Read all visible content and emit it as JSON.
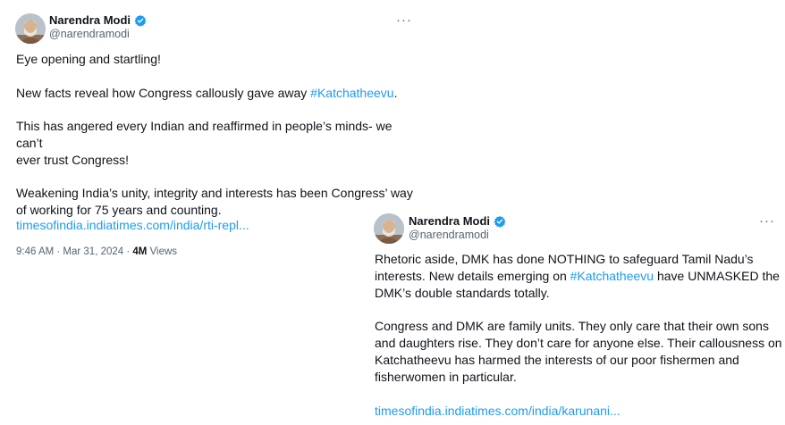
{
  "tweets": [
    {
      "author": {
        "name": "Narendra Modi",
        "handle": "@narendramodi",
        "verified_icon": "verified-badge-icon",
        "badge_color": "#1d9bf0"
      },
      "more_label": "···",
      "paragraphs": [
        {
          "text": "Eye opening and startling!"
        },
        {
          "before": "New facts reveal how Congress callously gave away ",
          "hashtag": "#Katchatheevu",
          "after": "."
        },
        {
          "line1": "This has angered every Indian and reaffirmed in people’s minds- we can’t",
          "line2": "ever trust Congress!"
        },
        {
          "line1": "Weakening India’s unity, integrity and interests has been Congress’ way",
          "line2": "of working for 75 years and counting."
        }
      ],
      "link": "timesofindia.indiatimes.com/india/rti-repl...",
      "time": "9:46 AM · Mar 31, 2024 · ",
      "views_count": "4M",
      "views_label": " Views"
    },
    {
      "author": {
        "name": "Narendra Modi",
        "handle": "@narendramodi",
        "verified_icon": "verified-badge-icon",
        "badge_color": "#1d9bf0"
      },
      "more_label": "···",
      "paragraphs": [
        {
          "line1": "Rhetoric aside, DMK has done NOTHING to safeguard Tamil Nadu’s",
          "line2_before": "interests. New details emerging on ",
          "hashtag": "#Katchatheevu",
          "line2_after": " have UNMASKED the",
          "line3": "DMK’s double standards totally."
        },
        {
          "line1": "Congress and DMK are family units. They only care that their own sons",
          "line2": "and daughters rise. They don’t care for anyone else. Their callousness on",
          "line3": "Katchatheevu has harmed the interests of our poor fishermen and",
          "line4": "fisherwomen in particular."
        }
      ],
      "link": "timesofindia.indiatimes.com/india/karunani..."
    }
  ],
  "colors": {
    "text": "#0f1419",
    "secondary": "#536471",
    "link": "#1d9bf0",
    "background": "#ffffff"
  }
}
